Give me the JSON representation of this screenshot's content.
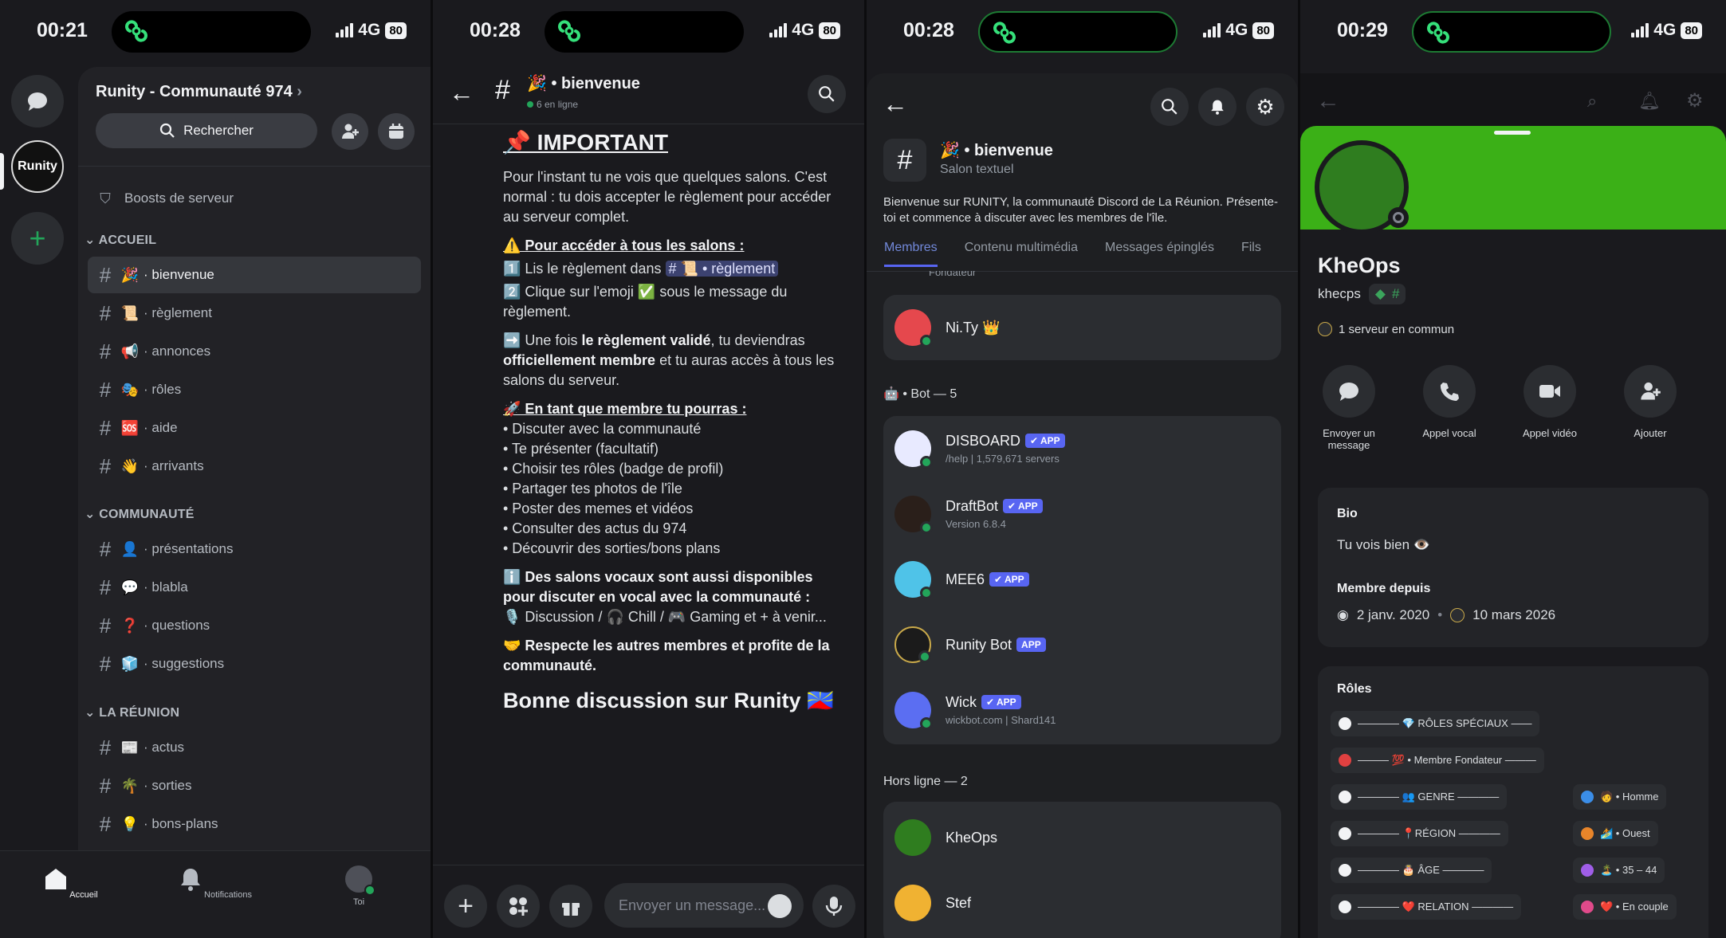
{
  "p1": {
    "time": "00:21",
    "net": "4G",
    "batt": "80",
    "server_name": "Runity - Communauté 974",
    "search": "Rechercher",
    "boosts": "Boosts de serveur",
    "cat1": "ACCUEIL",
    "cat2": "COMMUNAUTÉ",
    "cat3": "LA RÉUNION",
    "ch": [
      "bienvenue",
      "règlement",
      "annonces",
      "rôles",
      "aide",
      "arrivants",
      "présentations",
      "blabla",
      "questions",
      "suggestions",
      "actus",
      "sorties",
      "bons-plans"
    ],
    "emoji": [
      "🎉",
      "📜",
      "📢",
      "🎭",
      "🆘",
      "👋",
      "👤",
      "💬",
      "❓",
      "🧊",
      "📰",
      "🌴",
      "💡"
    ],
    "tab_home": "Accueil",
    "tab_notif": "Notifications",
    "tab_you": "Toi",
    "logo": "Runity"
  },
  "p2": {
    "time": "00:28",
    "net": "4G",
    "batt": "80",
    "channel": "🎉 • bienvenue",
    "online": "6 en ligne",
    "h": "📌 IMPORTANT",
    "t1": "Pour l'instant tu ne vois que quelques salons. C'est normal : tu dois accepter le règlement pour accéder au serveur complet.",
    "s1": "⚠️ Pour accéder à tous les salons :",
    "l1a": "1️⃣ Lis le règlement dans",
    "l1m": "# 📜 • règlement",
    "l2": "2️⃣ Clique sur l'emoji ✅ sous le message du règlement.",
    "t2a": "➡️ Une fois",
    "t2b": "le règlement validé",
    "t2c": ", tu deviendras",
    "t2d": "officiellement membre",
    "t2e": "et tu auras accès à tous les salons du serveur.",
    "s2": "🚀 En tant que membre tu pourras :",
    "list": [
      "• Discuter avec la communauté",
      "• Te présenter (facultatif)",
      "• Choisir tes rôles (badge de profil)",
      "• Partager tes photos de l'île",
      "• Poster des memes et vidéos",
      "• Consulter des actus du 974",
      "• Découvrir des sorties/bons plans"
    ],
    "s3": "ℹ️ Des salons vocaux sont aussi disponibles pour discuter en vocal avec la communauté :",
    "s3b": "🎙️ Discussion / 🎧 Chill / 🎮 Gaming et + à venir...",
    "s4": "🤝 Respecte les autres membres et profite de la communauté.",
    "final": "Bonne discussion sur Runity 🇷🇪",
    "placeholder": "Envoyer un message..."
  },
  "p3": {
    "time": "00:28",
    "net": "4G",
    "batt": "80",
    "channel": "🎉 • bienvenue",
    "type": "Salon textuel",
    "desc": "Bienvenue sur RUNITY, la communauté Discord de La Réunion. Présente-toi et commence à discuter avec les membres de l'île.",
    "tabs": [
      "Membres",
      "Contenu multimédia",
      "Messages épinglés",
      "Fils"
    ],
    "founder_label": "Fondateur",
    "founder": "Ni.Ty 👑",
    "bot_header": "🤖 • Bot — 5",
    "bots": [
      {
        "name": "DISBOARD",
        "sub": "/help | 1,579,671 servers",
        "color": "#e8eaff"
      },
      {
        "name": "DraftBot",
        "sub": "Version 6.8.4",
        "color": "#2a1f1a"
      },
      {
        "name": "MEE6",
        "sub": "",
        "color": "#4fc3e8"
      },
      {
        "name": "Runity Bot",
        "sub": "",
        "color": "#1b1b1b"
      },
      {
        "name": "Wick",
        "sub": "wickbot.com | Shard141",
        "color": "#5b6ef2"
      }
    ],
    "app": "APP",
    "offline_header": "Hors ligne — 2",
    "offline": [
      "KheOps",
      "Stef"
    ]
  },
  "p4": {
    "time": "00:29",
    "net": "4G",
    "batt": "80",
    "name": "KheOps",
    "handle": "khecps",
    "common": "1 serveur en commun",
    "actions": [
      "Envoyer un message",
      "Appel vocal",
      "Appel vidéo",
      "Ajouter"
    ],
    "bio_label": "Bio",
    "bio": "Tu vois bien 👁️",
    "since_label": "Membre depuis",
    "since1": "2 janv. 2020",
    "since2": "10 mars 2026",
    "roles_label": "Rôles",
    "roles": [
      {
        "t": "———— 💎 RÔLES SPÉCIAUX ——",
        "c": "#f2f3f5"
      },
      {
        "t": "——— 💯 • Membre Fondateur ———",
        "c": "#e04040"
      },
      {
        "t": "———— 👥 GENRE ————",
        "c": "#f2f3f5"
      },
      {
        "t": "🧑 • Homme",
        "c": "#3b8ee8"
      },
      {
        "t": "———— 📍RÉGION ————",
        "c": "#f2f3f5"
      },
      {
        "t": "🏄 • Ouest",
        "c": "#e8852a"
      },
      {
        "t": "———— 🎂 ÂGE ————",
        "c": "#f2f3f5"
      },
      {
        "t": "🏝️ • 35 – 44",
        "c": "#a05ee8"
      },
      {
        "t": "———— ❤️ RELATION ————",
        "c": "#f2f3f5"
      },
      {
        "t": "❤️ • En couple",
        "c": "#e04a8a"
      }
    ]
  }
}
